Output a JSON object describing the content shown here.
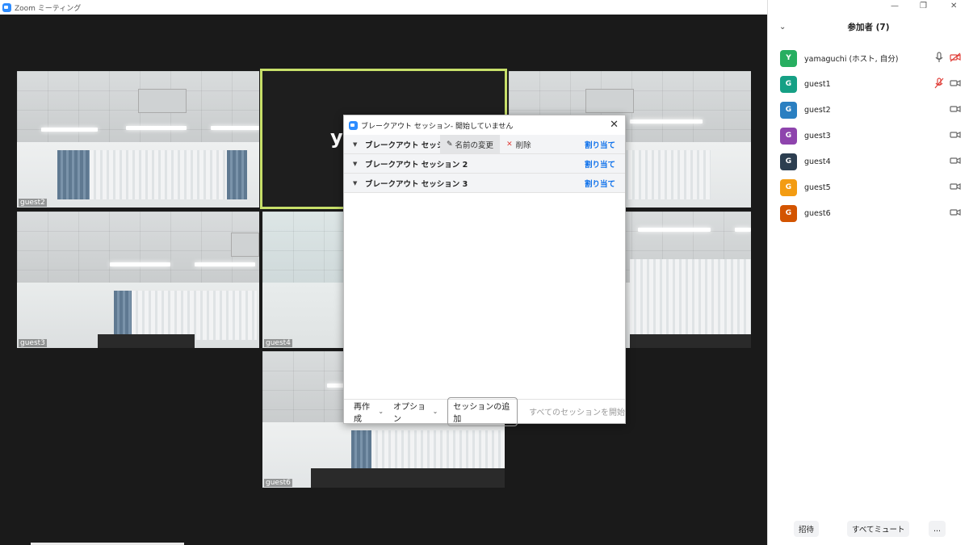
{
  "window": {
    "title": "Zoom ミーティング"
  },
  "tiles": [
    {
      "name": "guest2"
    },
    {
      "name": "guest3"
    },
    {
      "name": "guest4"
    },
    {
      "name": "guest6"
    }
  ],
  "speaker": {
    "initial_text": "y"
  },
  "dialog": {
    "title": "ブレークアウト セッション- 開始していません",
    "sessions": [
      {
        "name": "ブレークアウト セッシ...",
        "assign": "割り当て"
      },
      {
        "name": "ブレークアウト セッション 2",
        "assign": "割り当て"
      },
      {
        "name": "ブレークアウト セッション 3",
        "assign": "割り当て"
      }
    ],
    "row_actions": {
      "rename": "名前の変更",
      "delete": "削除"
    },
    "footer": {
      "recreate": "再作成",
      "options": "オプション",
      "add_session": "セッションの追加",
      "start_all": "すべてのセッションを開始"
    }
  },
  "participants": {
    "title": "参加者 (7)",
    "list": [
      {
        "initial": "Y",
        "name": "yamaguchi (ホスト, 自分)",
        "color": "#27ae60",
        "mic": "on",
        "cam": "off"
      },
      {
        "initial": "G",
        "name": "guest1",
        "color": "#16a085",
        "mic": "off",
        "cam": "on"
      },
      {
        "initial": "G",
        "name": "guest2",
        "color": "#2a7fc1",
        "mic": "none",
        "cam": "on"
      },
      {
        "initial": "G",
        "name": "guest3",
        "color": "#8e44ad",
        "mic": "none",
        "cam": "on"
      },
      {
        "initial": "G",
        "name": "guest4",
        "color": "#2c3e50",
        "mic": "none",
        "cam": "on"
      },
      {
        "initial": "G",
        "name": "guest5",
        "color": "#f39c12",
        "mic": "none",
        "cam": "on"
      },
      {
        "initial": "G",
        "name": "guest6",
        "color": "#d35400",
        "mic": "none",
        "cam": "on"
      }
    ],
    "buttons": {
      "invite": "招待",
      "mute_all": "すべてミュート",
      "more": "..."
    }
  },
  "colors": {
    "accent": "#0e71eb",
    "speaker_border": "#c8e06a",
    "muted_red": "#e0413b"
  }
}
